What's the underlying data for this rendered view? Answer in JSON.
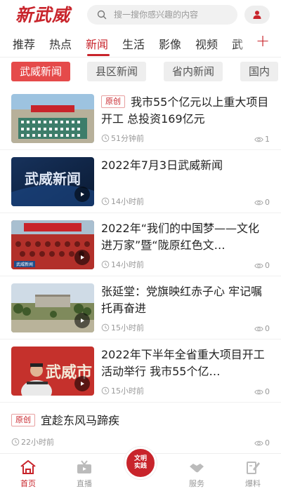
{
  "header": {
    "logo": "新武威",
    "search_placeholder": "搜一搜你感兴趣的内容"
  },
  "tabs": [
    "推荐",
    "热点",
    "新闻",
    "生活",
    "影像",
    "视频",
    "武"
  ],
  "active_tab": "新闻",
  "subtabs": [
    "武威新闻",
    "县区新闻",
    "省内新闻",
    "国内"
  ],
  "feed": [
    {
      "badge": "原创",
      "title": "我市55个亿元以上重大项目开工 总投资169亿元",
      "time": "51分钟前",
      "views": "1"
    },
    {
      "title": "2022年7月3日武威新闻",
      "time": "14小时前",
      "views": "0"
    },
    {
      "title": "2022年“我们的中国梦——文化进万家”暨“陇原红色文…",
      "time": "14小时前",
      "views": "0"
    },
    {
      "title": "张延堂：党旗映红赤子心 牢记嘱托再奋进",
      "time": "15小时前",
      "views": "0"
    },
    {
      "title": "2022年下半年全省重大项目开工活动举行 我市55个亿…",
      "time": "15小时前",
      "views": "0"
    },
    {
      "badge": "原创",
      "title": "宜趁东风马蹄疾",
      "time": "22小时前",
      "views": "0"
    }
  ],
  "thumb_text": {
    "tv": "武威新闻",
    "city": "武威市",
    "caption": "武威新闻"
  },
  "bottom_nav": {
    "home": "首页",
    "live": "直播",
    "center": "文明实践",
    "service": "服务",
    "report": "爆料"
  },
  "colors": {
    "accent": "#c8242b"
  }
}
